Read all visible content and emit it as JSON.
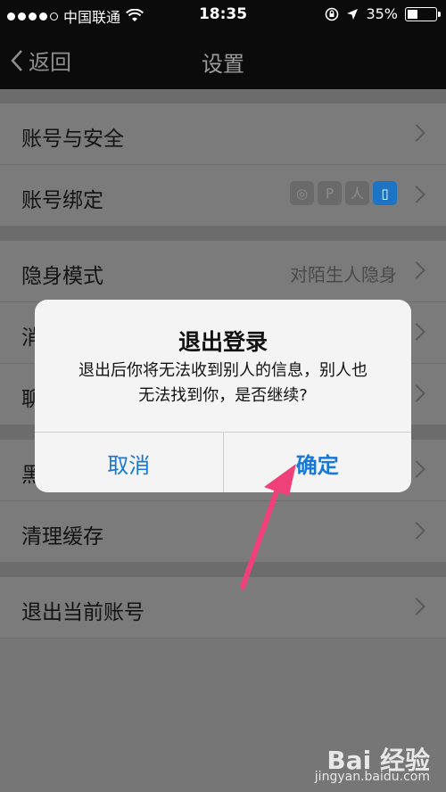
{
  "status": {
    "carrier": "中国联通",
    "time": "18:35",
    "battery": "35%",
    "battery_level": 0.35,
    "icons": [
      "signal-dots",
      "wifi-icon",
      "rotation-lock-icon",
      "location-arrow-icon",
      "battery-icon"
    ]
  },
  "nav": {
    "back_label": "返回",
    "title": "设置"
  },
  "groups": [
    [
      {
        "label": "账号与安全",
        "detail": ""
      },
      {
        "label": "账号绑定",
        "detail": ""
      }
    ],
    [
      {
        "label": "隐身模式",
        "detail": "对陌生人隐身"
      },
      {
        "label": "消",
        "detail": ""
      },
      {
        "label": "聊",
        "detail": ""
      }
    ],
    [
      {
        "label": "黑",
        "detail": ""
      },
      {
        "label": "清理缓存",
        "detail": ""
      }
    ],
    [
      {
        "label": "退出当前账号",
        "detail": ""
      }
    ]
  ],
  "binding_badges": [
    {
      "icon": "weibo-icon",
      "glyph": "◎",
      "active": false
    },
    {
      "icon": "tencent-weibo-icon",
      "glyph": "P",
      "active": false
    },
    {
      "icon": "renren-icon",
      "glyph": "人",
      "active": false
    },
    {
      "icon": "phone-icon",
      "glyph": "▯",
      "active": true
    }
  ],
  "dialog": {
    "title": "退出登录",
    "message_line1": "退出后你将无法收到别人的信息，别人也",
    "message_line2": "无法找到你，是否继续?",
    "cancel": "取消",
    "confirm": "确定"
  },
  "watermark": {
    "brand": "Bai 经验",
    "url": "jingyan.baidu.com"
  },
  "colors": {
    "accent": "#1878d8",
    "arrow": "#f0407a",
    "nav_bg": "#0b0b0b"
  }
}
